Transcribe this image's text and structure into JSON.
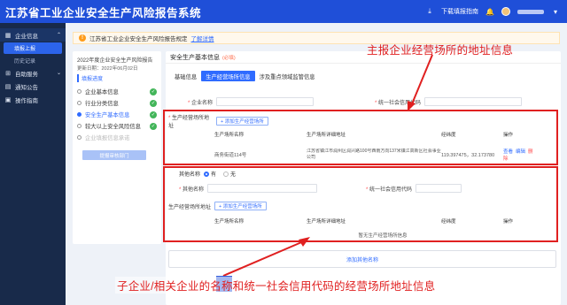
{
  "app": {
    "title": "江苏省工业企业安全生产风险报告系统",
    "download_label": "下载填报指南",
    "notification_count": "1",
    "colors": {
      "primary": "#2f6bff",
      "topbar": "#1f4fd8",
      "sidebar": "#182a4a",
      "annotation": "#e02020",
      "success": "#42b559"
    }
  },
  "sidebar": {
    "items": [
      {
        "label": "企业信息",
        "icon": "building-icon",
        "expanded": true,
        "children": [
          {
            "label": "填报上报",
            "active": true
          },
          {
            "label": "历史记录",
            "active": false
          }
        ]
      },
      {
        "label": "自助服务",
        "icon": "service-icon"
      },
      {
        "label": "通知公告",
        "icon": "bell-icon"
      },
      {
        "label": "操作指南",
        "icon": "book-icon"
      }
    ]
  },
  "notice": {
    "text": "江苏省工业企业安全生产风险报告规定",
    "link": "了解详情"
  },
  "progress": {
    "title": "2022年度企业安全生产风险报告",
    "date": "更新日期：2022年06月02日",
    "heading": "填报进度",
    "steps": [
      {
        "label": "企业基本信息",
        "status": "done"
      },
      {
        "label": "行业分类信息",
        "status": "done"
      },
      {
        "label": "安全生产基本信息",
        "status": "current"
      },
      {
        "label": "较大以上安全风险信息",
        "status": "done"
      },
      {
        "label": "企业填报信息承诺",
        "status": "pending"
      }
    ],
    "submit_label": "提报审核部门"
  },
  "form": {
    "section_title": "安全生产基本信息",
    "section_required": "(必填)",
    "tabs": [
      "基础信息",
      "生产经营场所信息",
      "涉及重点领域监管信息"
    ],
    "active_tab": 1,
    "company_name_label": "企业名称",
    "credit_code_label": "统一社会信用代码",
    "address_label": "生产经营场所地址",
    "add_address_label": "+ 添加生产经营场所",
    "table_headers": [
      "生产场所名称",
      "生产场所详细地址",
      "经纬度",
      "操作"
    ],
    "table_rows": [
      {
        "name": "商务街道114号",
        "address": "江苏省镇江市润州区润兴路100号西南方向137米镇江高新区社会事业公司",
        "coords": "119.397475，32.173780"
      }
    ],
    "row_actions": [
      "查看",
      "编辑",
      "删除"
    ],
    "other_name_toggle_label": "其他名称",
    "radio_yes": "有",
    "radio_no": "无",
    "other_name_label": "其他名称",
    "other_credit_label": "统一社会信用代码",
    "other_address_label": "生产经营场所地址",
    "other_add_address_label": "+ 添加生产经营场所",
    "empty_text": "暂无生产经营场所信息",
    "add_other_label": "添加其他名称"
  },
  "annotations": {
    "top": "主报企业经营场所的地址信息",
    "bottom": "子企业/相关企业的名称和统一社会信用代码的经营场所地址信息"
  }
}
